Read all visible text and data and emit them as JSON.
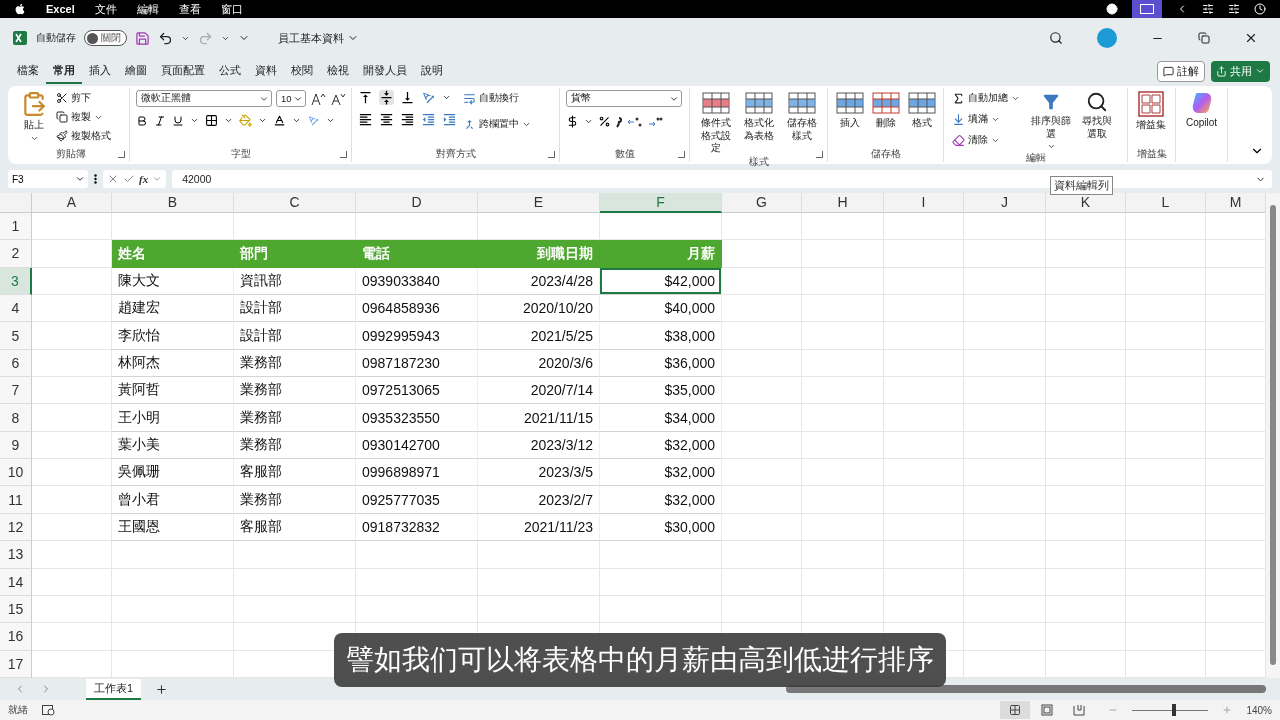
{
  "menubar": {
    "app": "Excel",
    "items": [
      "文件",
      "編輯",
      "查看",
      "窗口"
    ]
  },
  "titlebar": {
    "autosave_label": "自動儲存",
    "autosave": {
      "on": false,
      "label": "關閉"
    },
    "document": "員工基本資料"
  },
  "ribbon_tabs": [
    {
      "label": "檔案",
      "selected": false
    },
    {
      "label": "常用",
      "selected": true
    },
    {
      "label": "插入",
      "selected": false
    },
    {
      "label": "繪圖",
      "selected": false
    },
    {
      "label": "頁面配置",
      "selected": false
    },
    {
      "label": "公式",
      "selected": false
    },
    {
      "label": "資料",
      "selected": false
    },
    {
      "label": "校閱",
      "selected": false
    },
    {
      "label": "檢視",
      "selected": false
    },
    {
      "label": "開發人員",
      "selected": false
    },
    {
      "label": "說明",
      "selected": false
    }
  ],
  "comment_button": "註解",
  "share_button": "共用",
  "ribbon": [
    {
      "kind": "clipboard",
      "label": "剪貼簿",
      "paste": "貼上",
      "cut": "剪下",
      "copy": "複製",
      "format_painter": "複製格式"
    },
    {
      "kind": "font",
      "label": "字型",
      "font": "微軟正黑體",
      "size": "10"
    },
    {
      "kind": "alignment",
      "label": "對齊方式",
      "wrap": "自動換行",
      "merge": "跨欄置中"
    },
    {
      "kind": "number",
      "label": "數值",
      "format": "貨幣"
    },
    {
      "kind": "styles",
      "label": "樣式",
      "buttons": [
        "條件式格式設定",
        "格式化為表格",
        "儲存格樣式"
      ]
    },
    {
      "kind": "cells",
      "label": "儲存格",
      "buttons": [
        "插入",
        "刪除",
        "格式"
      ]
    },
    {
      "kind": "editing",
      "label": "編輯",
      "autosum": "自動加總",
      "fill": "填滿",
      "clear": "清除",
      "sort": "排序與篩選",
      "find": "尋找與選取"
    },
    {
      "kind": "addins",
      "label": "增益集",
      "buttons": [
        "增益集"
      ]
    },
    {
      "kind": "copilot",
      "button": "Copilot"
    }
  ],
  "formula_bar": {
    "name_box": "F3",
    "fx": "fx",
    "value": "42000",
    "tooltip": "資料編輯列"
  },
  "columns": [
    {
      "label": "A",
      "selected": false
    },
    {
      "label": "B",
      "selected": false
    },
    {
      "label": "C",
      "selected": false
    },
    {
      "label": "D",
      "selected": false
    },
    {
      "label": "E",
      "selected": false
    },
    {
      "label": "F",
      "selected": true
    },
    {
      "label": "G",
      "selected": false
    },
    {
      "label": "H",
      "selected": false
    },
    {
      "label": "I",
      "selected": false
    },
    {
      "label": "J",
      "selected": false
    },
    {
      "label": "K",
      "selected": false
    },
    {
      "label": "L",
      "selected": false
    },
    {
      "label": "M",
      "selected": false
    }
  ],
  "rows": [
    {
      "label": "1",
      "selected": false
    },
    {
      "label": "2",
      "selected": false
    },
    {
      "label": "3",
      "selected": true
    },
    {
      "label": "4",
      "selected": false
    },
    {
      "label": "5",
      "selected": false
    },
    {
      "label": "6",
      "selected": false
    },
    {
      "label": "7",
      "selected": false
    },
    {
      "label": "8",
      "selected": false
    },
    {
      "label": "9",
      "selected": false
    },
    {
      "label": "10",
      "selected": false
    },
    {
      "label": "11",
      "selected": false
    },
    {
      "label": "12",
      "selected": false
    },
    {
      "label": "13",
      "selected": false
    },
    {
      "label": "14",
      "selected": false
    },
    {
      "label": "15",
      "selected": false
    },
    {
      "label": "16",
      "selected": false
    },
    {
      "label": "17",
      "selected": false
    }
  ],
  "table": {
    "header": [
      "姓名",
      "部門",
      "電話",
      "到職日期",
      "月薪"
    ],
    "rows": [
      [
        {
          "text": "陳大文",
          "selected": false
        },
        {
          "text": "資訊部",
          "selected": false
        },
        {
          "text": "0939033840",
          "selected": false
        },
        {
          "text": "2023/4/28",
          "selected": false
        },
        {
          "text": "$42,000",
          "selected": true
        }
      ],
      [
        {
          "text": "趙建宏",
          "selected": false
        },
        {
          "text": "設計部",
          "selected": false
        },
        {
          "text": "0964858936",
          "selected": false
        },
        {
          "text": "2020/10/20",
          "selected": false
        },
        {
          "text": "$40,000",
          "selected": false
        }
      ],
      [
        {
          "text": "李欣怡",
          "selected": false
        },
        {
          "text": "設計部",
          "selected": false
        },
        {
          "text": "0992995943",
          "selected": false
        },
        {
          "text": "2021/5/25",
          "selected": false
        },
        {
          "text": "$38,000",
          "selected": false
        }
      ],
      [
        {
          "text": "林阿杰",
          "selected": false
        },
        {
          "text": "業務部",
          "selected": false
        },
        {
          "text": "0987187230",
          "selected": false
        },
        {
          "text": "2020/3/6",
          "selected": false
        },
        {
          "text": "$36,000",
          "selected": false
        }
      ],
      [
        {
          "text": "黃阿哲",
          "selected": false
        },
        {
          "text": "業務部",
          "selected": false
        },
        {
          "text": "0972513065",
          "selected": false
        },
        {
          "text": "2020/7/14",
          "selected": false
        },
        {
          "text": "$35,000",
          "selected": false
        }
      ],
      [
        {
          "text": "王小明",
          "selected": false
        },
        {
          "text": "業務部",
          "selected": false
        },
        {
          "text": "0935323550",
          "selected": false
        },
        {
          "text": "2021/11/15",
          "selected": false
        },
        {
          "text": "$34,000",
          "selected": false
        }
      ],
      [
        {
          "text": "葉小美",
          "selected": false
        },
        {
          "text": "業務部",
          "selected": false
        },
        {
          "text": "0930142700",
          "selected": false
        },
        {
          "text": "2023/3/12",
          "selected": false
        },
        {
          "text": "$32,000",
          "selected": false
        }
      ],
      [
        {
          "text": "吳佩珊",
          "selected": false
        },
        {
          "text": "客服部",
          "selected": false
        },
        {
          "text": "0996898971",
          "selected": false
        },
        {
          "text": "2023/3/5",
          "selected": false
        },
        {
          "text": "$32,000",
          "selected": false
        }
      ],
      [
        {
          "text": "曾小君",
          "selected": false
        },
        {
          "text": "業務部",
          "selected": false
        },
        {
          "text": "0925777035",
          "selected": false
        },
        {
          "text": "2023/2/7",
          "selected": false
        },
        {
          "text": "$32,000",
          "selected": false
        }
      ],
      [
        {
          "text": "王國恩",
          "selected": false
        },
        {
          "text": "客服部",
          "selected": false
        },
        {
          "text": "0918732832",
          "selected": false
        },
        {
          "text": "2021/11/23",
          "selected": false
        },
        {
          "text": "$30,000",
          "selected": false
        }
      ]
    ]
  },
  "sheet_tabs": [
    {
      "label": "工作表1",
      "selected": true
    }
  ],
  "status_bar": {
    "status": "就緒",
    "view": [
      {
        "kind": "normal",
        "selected": true
      },
      {
        "kind": "page_layout",
        "selected": false
      },
      {
        "kind": "page_break",
        "selected": false
      }
    ],
    "zoom": {
      "level": 0.55,
      "reading": "140%"
    }
  },
  "subtitle": "譬如我们可以将表格中的月薪由高到低进行排序"
}
